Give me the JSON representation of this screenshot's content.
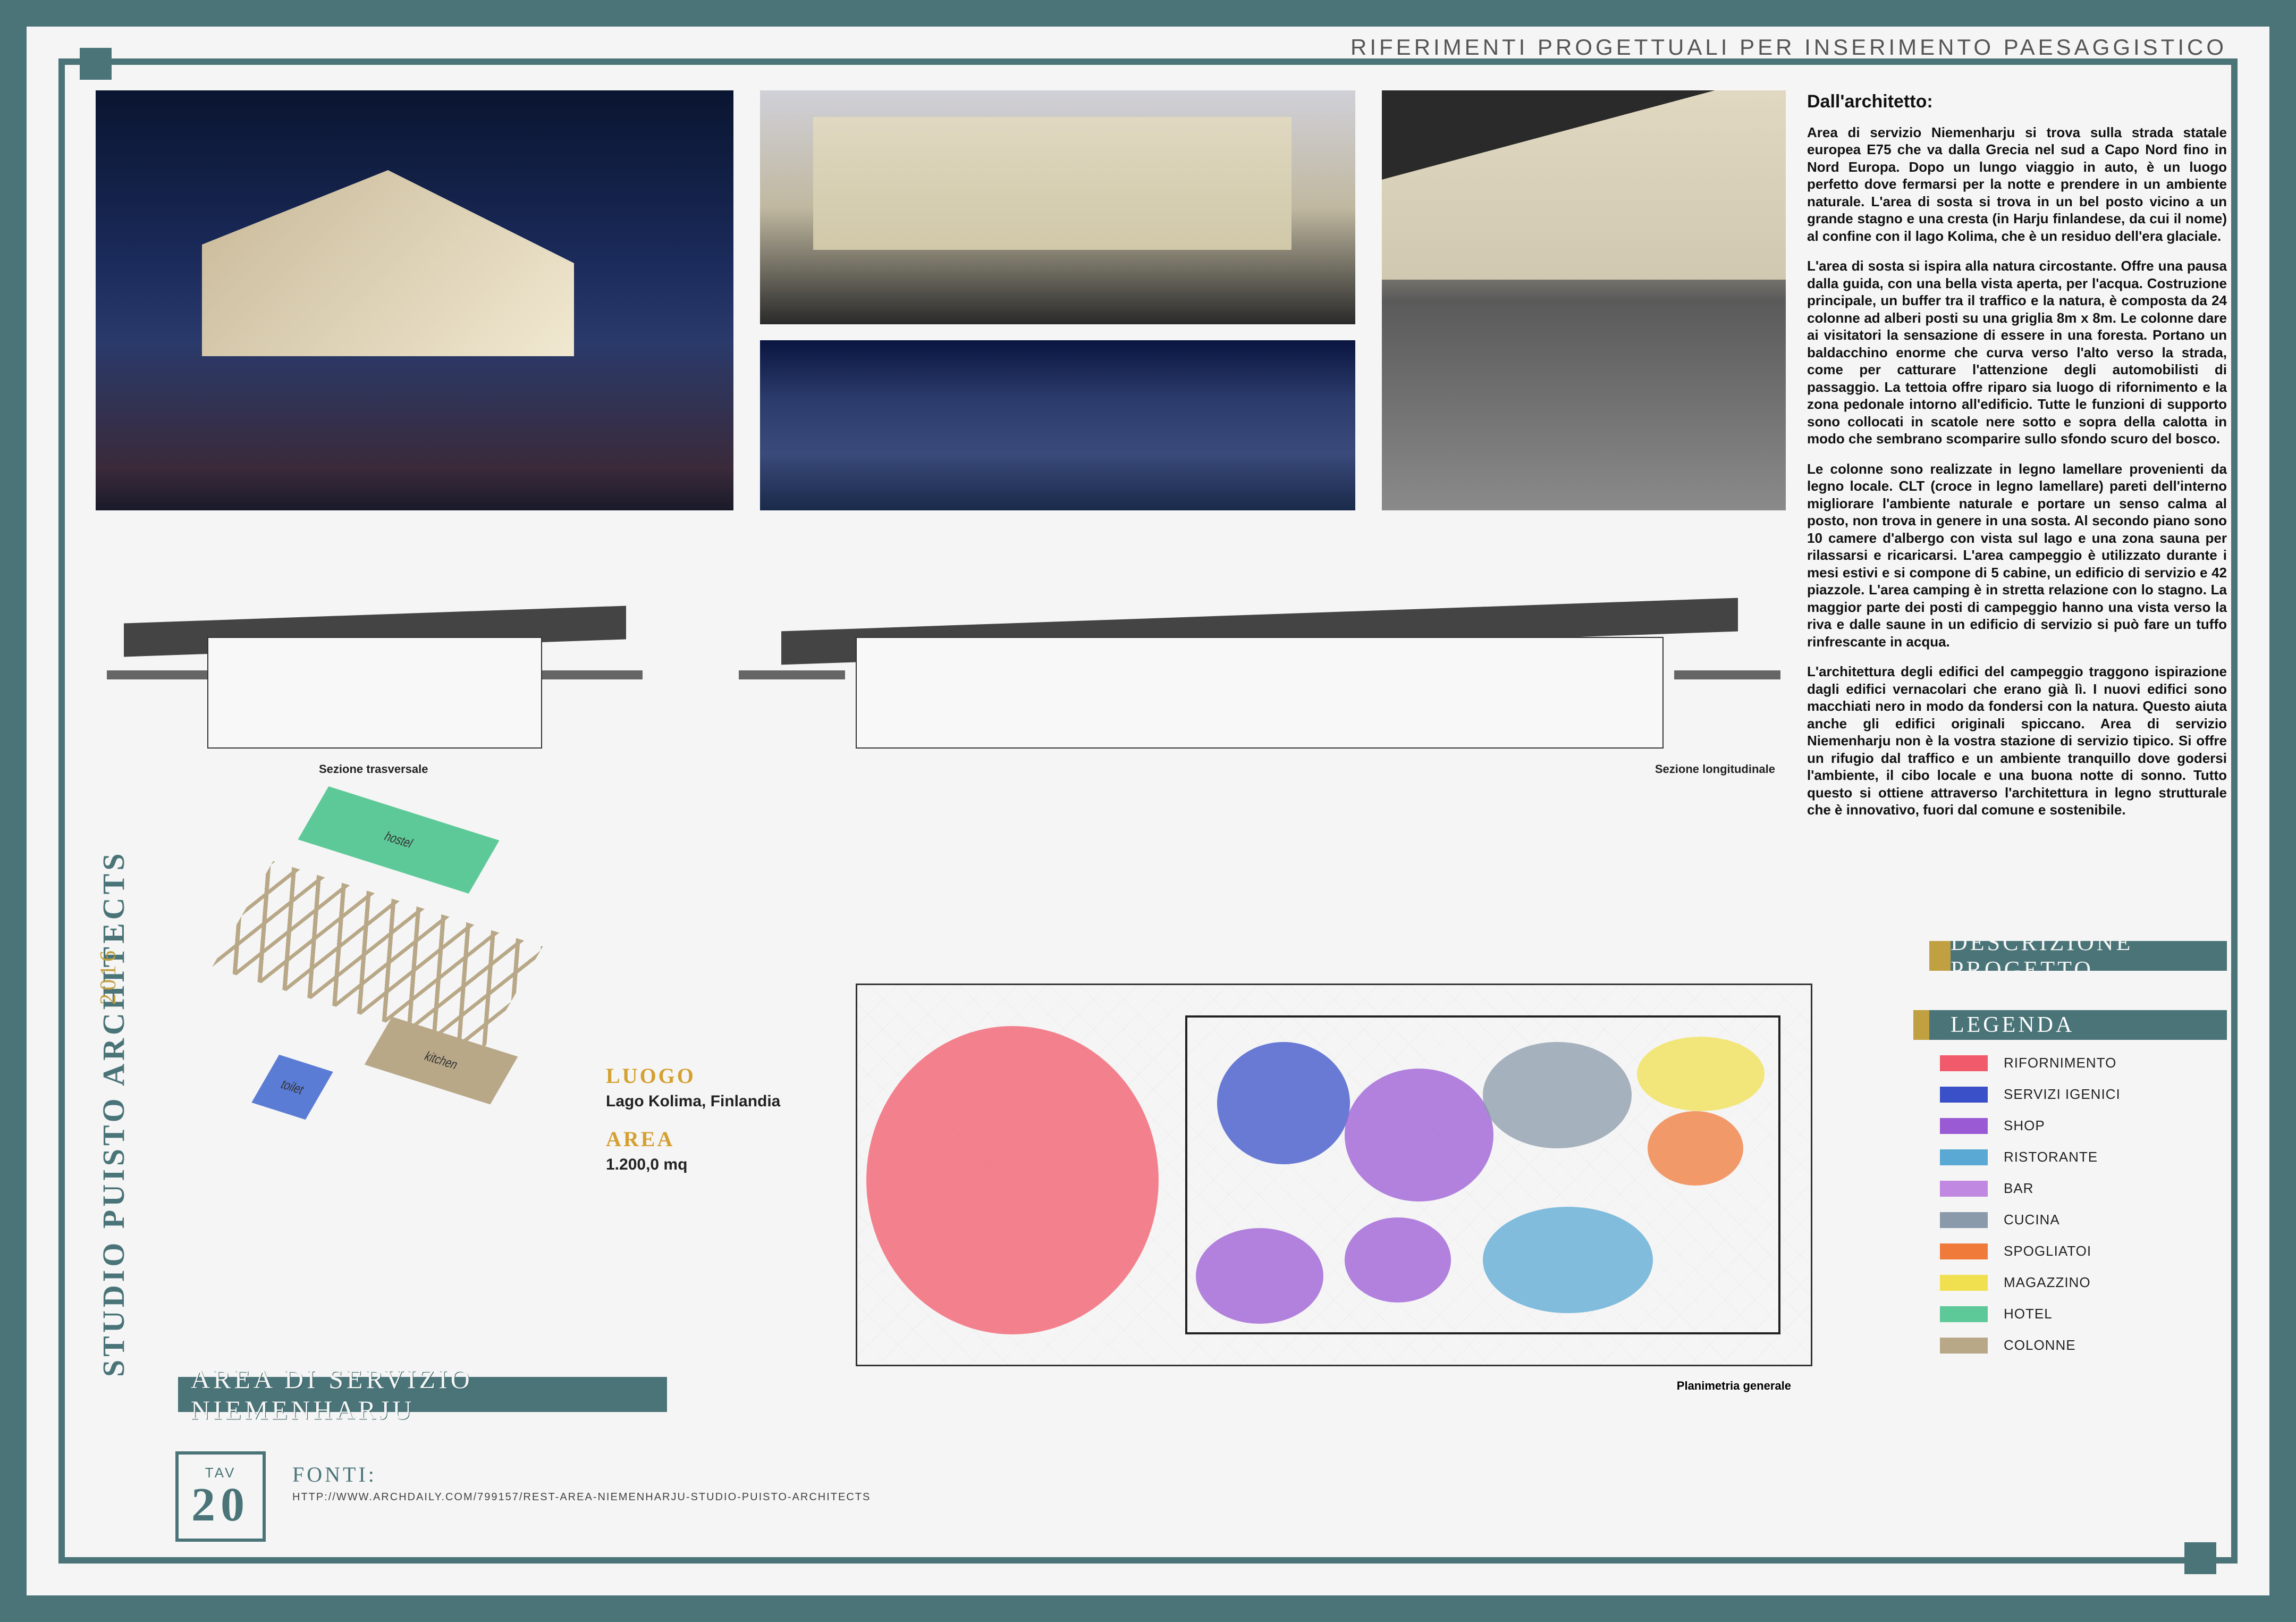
{
  "header": {
    "title": "RIFERIMENTI PROGETTUALI PER INSERIMENTO PAESAGGISTICO"
  },
  "sections": {
    "transverse": "Sezione trasversale",
    "longitudinal": "Sezione longitudinale"
  },
  "axon": {
    "hostel": "hostel",
    "kitchen": "kitchen",
    "toilet": "toilet"
  },
  "info": {
    "luogo_label": "LUOGO",
    "luogo": "Lago Kolima, Finlandia",
    "area_label": "AREA",
    "area": "1.200,0 mq"
  },
  "side": {
    "studio": "STUDIO PUISTO ARCHITECTS",
    "year": "2016"
  },
  "title_band": "AREA DI SERVIZIO NIEMENHARJU",
  "tav": {
    "label": "TAV",
    "num": "20"
  },
  "fonti": {
    "label": "FONTI:",
    "url": "HTTP://WWW.ARCHDAILY.COM/799157/REST-AREA-NIEMENHARJU-STUDIO-PUISTO-ARCHITECTS"
  },
  "plan_label": "Planimetria generale",
  "text": {
    "heading": "Dall'architetto:",
    "p1": "Area di servizio Niemenharju si trova sulla strada statale europea E75 che va dalla Grecia nel sud a Capo Nord fino in Nord Europa. Dopo un lungo viaggio in auto, è un luogo perfetto dove fermarsi per la notte e prendere in un ambiente naturale. L'area di sosta si trova in un bel posto vicino a un grande stagno e una cresta (in Harju finlandese, da cui il nome) al confine con il lago Kolima, che è un residuo dell'era glaciale.",
    "p2": "L'area di sosta si ispira alla natura circostante. Offre una pausa dalla guida, con una bella vista aperta, per l'acqua. Costruzione principale, un buffer tra il traffico e la natura, è composta da 24 colonne ad alberi posti su una griglia 8m x 8m. Le colonne dare ai visitatori la sensazione di essere in una foresta. Portano un baldacchino enorme che curva verso l'alto verso la strada, come per catturare l'attenzione degli automobilisti di passaggio. La tettoia offre riparo sia luogo di rifornimento e la zona pedonale intorno all'edificio. Tutte le funzioni di supporto sono collocati in scatole nere sotto e sopra della calotta in modo che sembrano scomparire sullo sfondo scuro del bosco.",
    "p3": "Le colonne sono realizzate in legno lamellare provenienti da legno locale. CLT (croce in legno lamellare) pareti dell'interno migliorare l'ambiente naturale e portare un senso calma al posto, non trova in genere in una sosta. Al secondo piano sono 10 camere d'albergo con vista sul lago e una zona sauna per rilassarsi e ricaricarsi. L'area campeggio è utilizzato durante i mesi estivi e si compone di 5 cabine, un edificio di servizio e 42 piazzole. L'area camping è in stretta relazione con lo stagno. La maggior parte dei posti di campeggio hanno una vista verso la riva e dalle saune in un edificio di servizio si può fare un tuffo rinfrescante in acqua.",
    "p4": "L'architettura degli edifici del campeggio traggono ispirazione dagli edifici vernacolari che erano già lì. I nuovi edifici sono macchiati nero in modo da fondersi con la natura. Questo aiuta anche gli edifici originali spiccano. Area di servizio Niemenharju non è la vostra stazione di servizio tipico. Si offre un rifugio dal traffico e un ambiente tranquillo dove godersi l'ambiente, il cibo locale e una buona notte di sonno. Tutto questo si ottiene attraverso l'architettura in legno strutturale che è innovativo, fuori dal comune e sostenibile."
  },
  "desc_band": "DESCRIZIONE PROGETTO",
  "legend": {
    "title": "LEGENDA",
    "items": [
      {
        "label": "RIFORNIMENTO",
        "color": "#f15a6a"
      },
      {
        "label": "SERVIZI IGENICI",
        "color": "#3a50c8"
      },
      {
        "label": "SHOP",
        "color": "#9a5ad4"
      },
      {
        "label": "RISTORANTE",
        "color": "#5aa8d4"
      },
      {
        "label": "BAR",
        "color": "#c088e0"
      },
      {
        "label": "CUCINA",
        "color": "#8a9aaa"
      },
      {
        "label": "SPOGLIATOI",
        "color": "#f07a3a"
      },
      {
        "label": "MAGAZZINO",
        "color": "#f0e050"
      },
      {
        "label": "HOTEL",
        "color": "#5ec998"
      },
      {
        "label": "COLONNE",
        "color": "#b8a888"
      }
    ]
  }
}
